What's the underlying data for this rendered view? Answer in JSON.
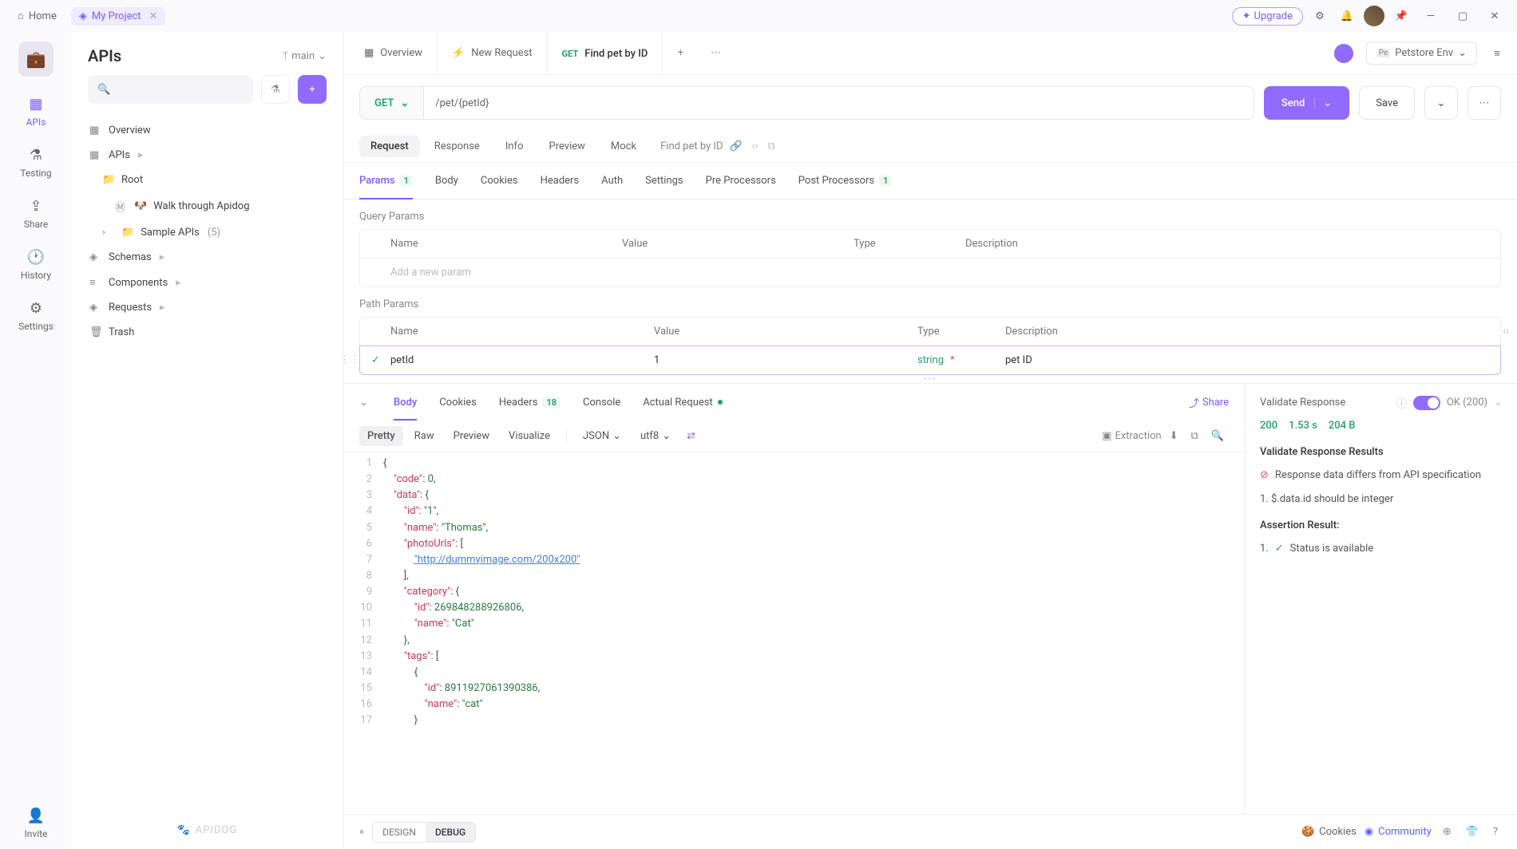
{
  "titlebar": {
    "home": "Home",
    "project": "My Project",
    "upgrade": "Upgrade"
  },
  "rail": {
    "apis": "APIs",
    "testing": "Testing",
    "share": "Share",
    "history": "History",
    "settings": "Settings",
    "invite": "Invite"
  },
  "sidebar": {
    "title": "APIs",
    "branch": "main",
    "tree": {
      "overview": "Overview",
      "apis": "APIs",
      "root": "Root",
      "walk": "Walk through Apidog",
      "sample": "Sample APIs",
      "sample_count": "(5)",
      "schemas": "Schemas",
      "components": "Components",
      "requests": "Requests",
      "trash": "Trash"
    },
    "footer": "APIDOG"
  },
  "tabs": {
    "overview": "Overview",
    "newreq": "New Request",
    "find_method": "GET",
    "find_label": "Find pet by ID",
    "env_badge": "Pe",
    "env": "Petstore Env"
  },
  "url": {
    "method": "GET",
    "path": "/pet/{petId}",
    "send": "Send",
    "save": "Save"
  },
  "subtabs": {
    "request": "Request",
    "response": "Response",
    "info": "Info",
    "preview": "Preview",
    "mock": "Mock",
    "name": "Find pet by ID"
  },
  "reqtabs": {
    "params": "Params",
    "params_n": "1",
    "body": "Body",
    "cookies": "Cookies",
    "headers": "Headers",
    "auth": "Auth",
    "settings": "Settings",
    "pre": "Pre Processors",
    "post": "Post Processors",
    "post_n": "1"
  },
  "query": {
    "title": "Query Params",
    "h_name": "Name",
    "h_value": "Value",
    "h_type": "Type",
    "h_desc": "Description",
    "placeholder": "Add a new param"
  },
  "path": {
    "title": "Path Params",
    "h_name": "Name",
    "h_value": "Value",
    "h_type": "Type",
    "h_desc": "Description",
    "row": {
      "name": "petId",
      "value": "1",
      "type": "string",
      "desc": "pet ID"
    }
  },
  "resptabs": {
    "body": "Body",
    "cookies": "Cookies",
    "headers": "Headers",
    "headers_n": "18",
    "console": "Console",
    "actual": "Actual Request",
    "share": "Share"
  },
  "rtools": {
    "pretty": "Pretty",
    "raw": "Raw",
    "preview": "Preview",
    "visualize": "Visualize",
    "json": "JSON",
    "utf8": "utf8",
    "extraction": "Extraction"
  },
  "code_lines": [
    [
      [
        "punc",
        "{"
      ]
    ],
    [
      [
        "pad",
        "    "
      ],
      [
        "key",
        "\"code\""
      ],
      [
        "punc",
        ": "
      ],
      [
        "num",
        "0"
      ],
      [
        "punc",
        ","
      ]
    ],
    [
      [
        "pad",
        "    "
      ],
      [
        "key",
        "\"data\""
      ],
      [
        "punc",
        ": "
      ],
      [
        "punc",
        "{"
      ]
    ],
    [
      [
        "pad",
        "        "
      ],
      [
        "key",
        "\"id\""
      ],
      [
        "punc",
        ": "
      ],
      [
        "str",
        "\"1\""
      ],
      [
        "punc",
        ","
      ]
    ],
    [
      [
        "pad",
        "        "
      ],
      [
        "key",
        "\"name\""
      ],
      [
        "punc",
        ": "
      ],
      [
        "str",
        "\"Thomas\""
      ],
      [
        "punc",
        ","
      ]
    ],
    [
      [
        "pad",
        "        "
      ],
      [
        "key",
        "\"photoUrls\""
      ],
      [
        "punc",
        ": ["
      ]
    ],
    [
      [
        "pad",
        "            "
      ],
      [
        "url",
        "\"http://dummyimage.com/200x200\""
      ]
    ],
    [
      [
        "pad",
        "        "
      ],
      [
        "punc",
        "],"
      ]
    ],
    [
      [
        "pad",
        "        "
      ],
      [
        "key",
        "\"category\""
      ],
      [
        "punc",
        ": "
      ],
      [
        "punc",
        "{"
      ]
    ],
    [
      [
        "pad",
        "            "
      ],
      [
        "key",
        "\"id\""
      ],
      [
        "punc",
        ": "
      ],
      [
        "num",
        "269848288926806"
      ],
      [
        "punc",
        ","
      ]
    ],
    [
      [
        "pad",
        "            "
      ],
      [
        "key",
        "\"name\""
      ],
      [
        "punc",
        ": "
      ],
      [
        "str",
        "\"Cat\""
      ]
    ],
    [
      [
        "pad",
        "        "
      ],
      [
        "punc",
        "},"
      ]
    ],
    [
      [
        "pad",
        "        "
      ],
      [
        "key",
        "\"tags\""
      ],
      [
        "punc",
        ": ["
      ]
    ],
    [
      [
        "pad",
        "            "
      ],
      [
        "punc",
        "{"
      ]
    ],
    [
      [
        "pad",
        "                "
      ],
      [
        "key",
        "\"id\""
      ],
      [
        "punc",
        ": "
      ],
      [
        "num",
        "8911927061390386"
      ],
      [
        "punc",
        ","
      ]
    ],
    [
      [
        "pad",
        "                "
      ],
      [
        "key",
        "\"name\""
      ],
      [
        "punc",
        ": "
      ],
      [
        "str",
        "\"cat\""
      ]
    ],
    [
      [
        "pad",
        "            "
      ],
      [
        "punc",
        "}"
      ]
    ]
  ],
  "validate": {
    "title": "Validate Response",
    "ok": "OK (200)",
    "status": "200",
    "time": "1.53 s",
    "size": "204 B",
    "results_title": "Validate Response Results",
    "err1": "Response data differs from API specification",
    "err2": "1. $.data.id should be integer",
    "assert_title": "Assertion Result:",
    "assert1": "Status is available",
    "assert1_prefix": "1."
  },
  "footer": {
    "design": "DESIGN",
    "debug": "DEBUG",
    "cookies": "Cookies",
    "community": "Community"
  }
}
